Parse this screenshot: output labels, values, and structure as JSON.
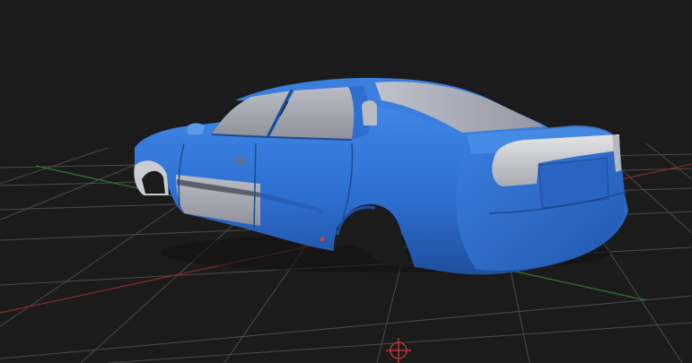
{
  "viewport": {
    "background_color": "#1b1b1b",
    "grid_line_color": "#4a4a4a",
    "x_axis_color": "#8a2a2a",
    "z_axis_color": "#2f7a2f",
    "gizmo_color": "#b23a3a"
  },
  "model": {
    "kind": "car-body-shell",
    "primary_paint": "#2f6fd0",
    "unpainted_panel": "#a6a9b4",
    "taillight_color": "#c8cace"
  },
  "icons": {
    "origin_gizmo": "crosshair-circle-icon"
  }
}
